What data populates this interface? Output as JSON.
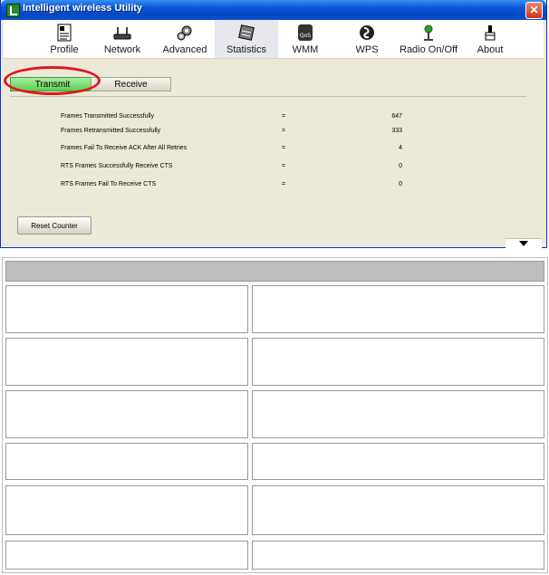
{
  "window": {
    "title": "Intelligent wireless Utility"
  },
  "toolbar": {
    "items": [
      {
        "label": "Profile",
        "icon": "profile-icon"
      },
      {
        "label": "Network",
        "icon": "network-icon"
      },
      {
        "label": "Advanced",
        "icon": "advanced-icon"
      },
      {
        "label": "Statistics",
        "icon": "statistics-icon",
        "active": true
      },
      {
        "label": "WMM",
        "icon": "wmm-icon"
      },
      {
        "label": "WPS",
        "icon": "wps-icon"
      },
      {
        "label": "Radio On/Off",
        "icon": "radio-icon"
      },
      {
        "label": "About",
        "icon": "about-icon"
      }
    ]
  },
  "tabs": {
    "transmit": "Transmit",
    "receive": "Receive"
  },
  "stats": [
    {
      "label": "Frames Transmitted Successfully",
      "eq": "=",
      "value": "647"
    },
    {
      "label": "Frames Retransmitted Successfully",
      "eq": "=",
      "value": "333"
    },
    {
      "label": "Frames Fail To Receive ACK After All Retries",
      "eq": "=",
      "value": "4"
    },
    {
      "label": "RTS Frames Successfully Receive CTS",
      "eq": "=",
      "value": "0"
    },
    {
      "label": "RTS Frames Fail To Receive CTS",
      "eq": "=",
      "value": "0"
    }
  ],
  "buttons": {
    "reset": "Reset Counter"
  },
  "colors": {
    "active_tab": "#5ccf4f",
    "highlight": "#e0161c",
    "titlebar": "#0a5bd8"
  }
}
